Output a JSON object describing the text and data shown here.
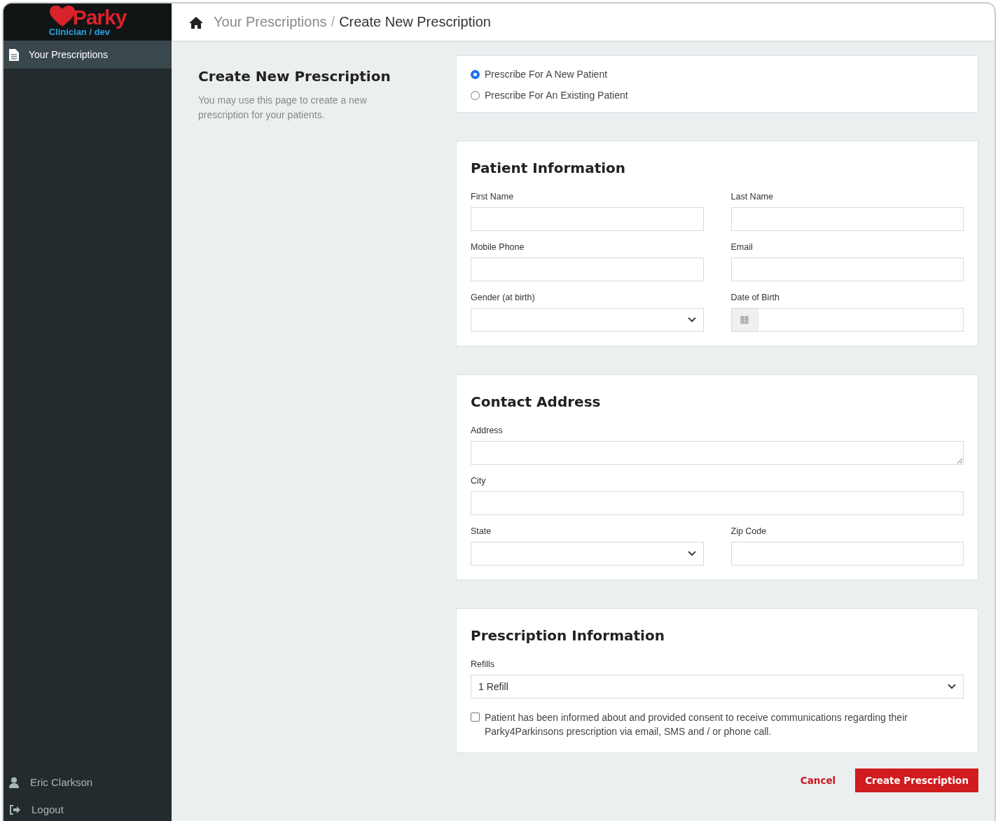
{
  "brand": {
    "name": "Parky",
    "subtitle": "Clinician / dev"
  },
  "sidebar": {
    "items": [
      {
        "label": "Your Prescriptions",
        "selected": true
      }
    ],
    "footer": [
      {
        "kind": "user",
        "label": "Eric Clarkson"
      },
      {
        "kind": "logout",
        "label": "Logout"
      }
    ]
  },
  "breadcrumb": {
    "parent": "Your Prescriptions",
    "separator": "/",
    "current": "Create New Prescription"
  },
  "intro": {
    "title": "Create New Prescription",
    "description": "You may use this page to create a new prescription for your patients."
  },
  "patient_type": [
    {
      "label": "Prescribe For A New Patient",
      "selected": true
    },
    {
      "label": "Prescribe For An Existing Patient",
      "selected": false
    }
  ],
  "sections": [
    {
      "title": "Patient Information",
      "rows": [
        [
          {
            "label": "First Name",
            "kind": "text"
          },
          {
            "label": "Last Name",
            "kind": "text"
          }
        ],
        [
          {
            "label": "Mobile Phone",
            "kind": "text"
          },
          {
            "label": "Email",
            "kind": "text"
          }
        ],
        [
          {
            "label": "Gender (at birth)",
            "kind": "select"
          },
          {
            "label": "Date of Birth",
            "kind": "date"
          }
        ]
      ]
    },
    {
      "title": "Contact Address",
      "rows": [
        [
          {
            "label": "Address",
            "kind": "textarea"
          }
        ],
        [
          {
            "label": "City",
            "kind": "text"
          }
        ],
        [
          {
            "label": "State",
            "kind": "select"
          },
          {
            "label": "Zip Code",
            "kind": "text"
          }
        ]
      ]
    },
    {
      "title": "Prescription Information",
      "rows": [
        [
          {
            "label": "Refills",
            "kind": "select",
            "value": "1 Refill"
          }
        ]
      ],
      "consent": {
        "label": "Patient has been informed about and provided consent to receive communications regarding their Parky4Parkinsons prescription via email, SMS and / or phone call.",
        "checked": false
      }
    }
  ],
  "actions": {
    "cancel": "Cancel",
    "submit": "Create Prescription"
  }
}
